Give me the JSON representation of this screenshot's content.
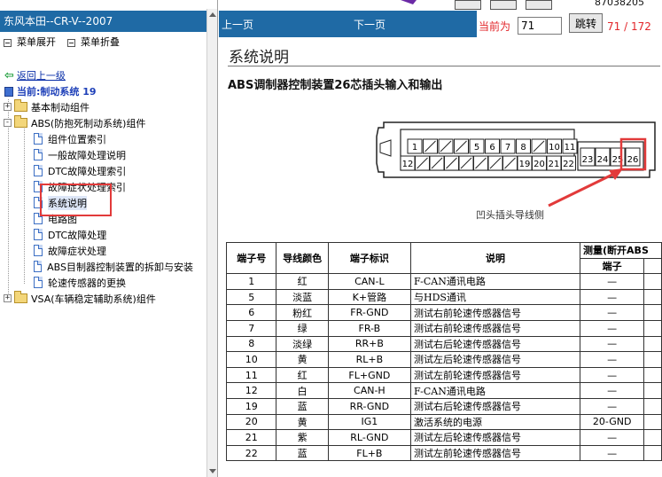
{
  "left": {
    "title": "东风本田--CR-V--2007",
    "expand_all": "菜单展开",
    "collapse_all": "菜单折叠",
    "back": "返回上一级",
    "current": "当前:制动系统 19",
    "tree": [
      {
        "label": "基本制动组件",
        "type": "folder",
        "state": "+",
        "indent": 0
      },
      {
        "label": "ABS(防抱死制动系统)组件",
        "type": "folder",
        "state": "-",
        "indent": 0
      },
      {
        "label": "组件位置索引",
        "type": "doc",
        "indent": 1
      },
      {
        "label": "一般故障处理说明",
        "type": "doc",
        "indent": 1
      },
      {
        "label": "DTC故障处理索引",
        "type": "doc",
        "indent": 1
      },
      {
        "label": "故障症状处理索引",
        "type": "doc",
        "indent": 1
      },
      {
        "label": "系统说明",
        "type": "doc",
        "indent": 1,
        "selected": true
      },
      {
        "label": "电路图",
        "type": "doc",
        "indent": 1
      },
      {
        "label": "DTC故障处理",
        "type": "doc",
        "indent": 1
      },
      {
        "label": "故障症状处理",
        "type": "doc",
        "indent": 1
      },
      {
        "label": "ABS目制器控制装置的拆卸与安装",
        "type": "doc",
        "indent": 1
      },
      {
        "label": "轮速传感器的更换",
        "type": "doc",
        "indent": 1
      },
      {
        "label": "VSA(车辆稳定辅助系统)组件",
        "type": "folder",
        "state": "+",
        "indent": 0
      }
    ]
  },
  "nav": {
    "prev": "上一页",
    "next": "下一页",
    "current_label": "当前为",
    "page_value": "71",
    "jump": "跳转",
    "page_count": "71 / 172",
    "top_code": "87038205"
  },
  "doc": {
    "title": "系统说明",
    "subtitle": "ABS调制器控制装置26芯插头输入和输出",
    "caption": "凹头插头导线侧",
    "pins_top": [
      "1",
      "",
      "",
      "",
      "5",
      "6",
      "7",
      "8",
      "",
      "10",
      "11"
    ],
    "pins_bottom": [
      "12",
      "",
      "",
      "",
      "",
      "",
      "",
      "",
      "19",
      "20",
      "21",
      "22"
    ],
    "pins_right": [
      "23",
      "24",
      "25",
      "26"
    ],
    "table": {
      "headers": [
        "端子号",
        "导线颜色",
        "端子标识",
        "说明",
        "测量(断开ABS"
      ],
      "subheader": "端子",
      "rows": [
        {
          "no": "1",
          "color": "红",
          "term": "CAN-L",
          "desc": "F-CAN通讯电路",
          "meas": "—"
        },
        {
          "no": "5",
          "color": "淡蓝",
          "term": "K+管路",
          "desc": "与HDS通讯",
          "meas": "—"
        },
        {
          "no": "6",
          "color": "粉红",
          "term": "FR-GND",
          "desc": "测试右前轮速传感器信号",
          "meas": "—"
        },
        {
          "no": "7",
          "color": "绿",
          "term": "FR-B",
          "desc": "测试右前轮速传感器信号",
          "meas": "—"
        },
        {
          "no": "8",
          "color": "淡绿",
          "term": "RR+B",
          "desc": "测试右后轮速传感器信号",
          "meas": "—"
        },
        {
          "no": "10",
          "color": "黄",
          "term": "RL+B",
          "desc": "测试左后轮速传感器信号",
          "meas": "—"
        },
        {
          "no": "11",
          "color": "红",
          "term": "FL+GND",
          "desc": "测试左前轮速传感器信号",
          "meas": "—"
        },
        {
          "no": "12",
          "color": "白",
          "term": "CAN-H",
          "desc": "F-CAN通讯电路",
          "meas": "—"
        },
        {
          "no": "19",
          "color": "蓝",
          "term": "RR-GND",
          "desc": "测试右后轮速传感器信号",
          "meas": "—"
        },
        {
          "no": "20",
          "color": "黄",
          "term": "IG1",
          "desc": "激活系统的电源",
          "meas": "20-GND"
        },
        {
          "no": "21",
          "color": "紫",
          "term": "RL-GND",
          "desc": "测试左后轮速传感器信号",
          "meas": "—"
        },
        {
          "no": "22",
          "color": "蓝",
          "term": "FL+B",
          "desc": "测试左前轮速传感器信号",
          "meas": "—"
        }
      ]
    }
  },
  "colors": {
    "nav_blue": "#1f6aa5",
    "accent_red": "#e2262a",
    "link_blue": "#0a2fa8"
  }
}
